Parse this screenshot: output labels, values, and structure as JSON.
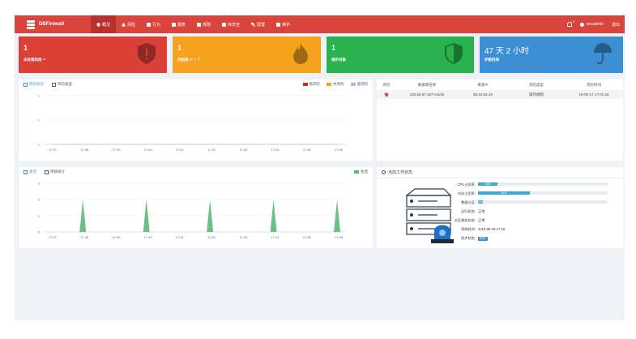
{
  "app": {
    "name": "DBFirewall"
  },
  "nav": [
    {
      "label": "概况",
      "icon": "home-icon",
      "active": true
    },
    {
      "label": "风险",
      "icon": "warning-icon",
      "active": false
    },
    {
      "label": "行为",
      "icon": "edit-icon",
      "active": false
    },
    {
      "label": "报表",
      "icon": "report-icon",
      "active": false
    },
    {
      "label": "规则",
      "icon": "rules-icon",
      "active": false
    },
    {
      "label": "库安全",
      "icon": "database-icon",
      "active": false
    },
    {
      "label": "配置",
      "icon": "wrench-icon",
      "active": false
    },
    {
      "label": "维护",
      "icon": "maintenance-icon",
      "active": false
    }
  ],
  "topright": {
    "notifications": "0",
    "user": "secadmin",
    "logout": "退出"
  },
  "tiles": [
    {
      "value": "1",
      "label": "未处理风险",
      "color": "#db4037",
      "icon": "shield-alert-icon"
    },
    {
      "value": "1",
      "label": "风险源",
      "extra": "IP 1 个",
      "color": "#f5a21f",
      "icon": "fire-icon"
    },
    {
      "value": "1",
      "label": "保护对象",
      "color": "#29b24d",
      "icon": "shield-icon"
    },
    {
      "value": "47 天 2 小时",
      "label": "护航时间",
      "color": "#3c8fd3",
      "icon": "umbrella-icon"
    }
  ],
  "risk_panel": {
    "tabs": [
      "风险统计",
      "风险类型"
    ],
    "legend": [
      {
        "name": "低风险",
        "color": "#d9261c"
      },
      {
        "name": "中风险",
        "color": "#f5a21f"
      },
      {
        "name": "低风险",
        "color": "#a9b8ea"
      }
    ]
  },
  "risk_table": {
    "headers": [
      "风险",
      "数据库名称",
      "来源IP",
      "风险类型",
      "风险时间"
    ],
    "rows": [
      {
        "db": "182.92.97.187-oracle",
        "ip": "60.24.64.19",
        "type": "操作规则",
        "time": "18-05-17 17:01:44"
      }
    ]
  },
  "session_panel": {
    "tabs": [
      "会话",
      "审核统计"
    ],
    "legend": [
      {
        "name": "会话",
        "color": "#5cb87a"
      }
    ]
  },
  "state_panel": {
    "title": "当前工作状态",
    "rows": [
      {
        "label": "CPU占用率:",
        "kind": "bar",
        "text": "15%",
        "value": 0.15
      },
      {
        "label": "内存占用率:",
        "kind": "bar",
        "text": "40%",
        "value": 0.4
      },
      {
        "label": "数据分区:",
        "kind": "bar",
        "text": "4%",
        "value": 0.04
      },
      {
        "label": "运行状态:",
        "kind": "text",
        "text": "正常"
      },
      {
        "label": "分区服务状态:",
        "kind": "text",
        "text": "正常"
      },
      {
        "label": "系统时间:",
        "kind": "text",
        "text": "2018-05-28 17:46"
      },
      {
        "label": "同步状态:",
        "kind": "tag",
        "text": "同步"
      }
    ]
  },
  "chart_data": [
    {
      "type": "area",
      "x": [
        "17:37",
        "17:38",
        "17:39",
        "17:40",
        "17:41",
        "17:42",
        "17:43",
        "17:44",
        "17:45",
        "17:46"
      ],
      "ylim": [
        0,
        1
      ],
      "yticks": [
        "1",
        "1",
        "1"
      ],
      "series": [
        {
          "name": "低风险",
          "values": [
            0,
            0,
            0,
            0,
            0,
            0,
            0,
            0,
            0,
            0
          ]
        },
        {
          "name": "中风险",
          "values": [
            0,
            0,
            0,
            0,
            0,
            0,
            0,
            0,
            0,
            0
          ]
        }
      ]
    },
    {
      "type": "area",
      "x": [
        "17:37",
        "17:38",
        "17:39",
        "17:40",
        "17:41",
        "17:42",
        "17:43",
        "17:44",
        "17:45",
        "17:46"
      ],
      "ylim": [
        0,
        3
      ],
      "yticks": [
        "0",
        "1",
        "2",
        "3"
      ],
      "series": [
        {
          "name": "会话",
          "peaks": [
            2,
            2,
            2,
            2,
            2
          ],
          "peak_positions": [
            0.95,
            2.95,
            4.95,
            6.95,
            8.95
          ]
        }
      ]
    }
  ]
}
